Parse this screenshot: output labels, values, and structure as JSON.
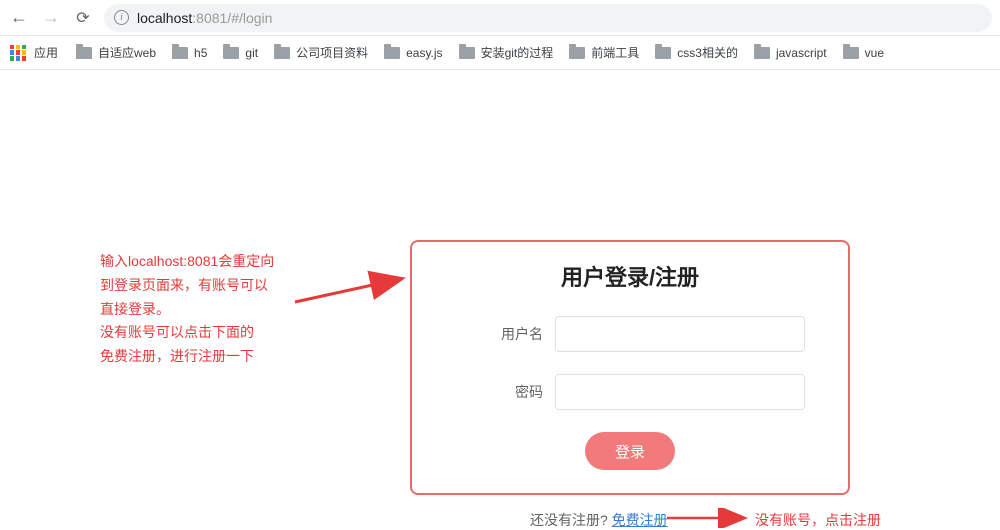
{
  "browser": {
    "url_host": "localhost",
    "url_rest": ":8081/#/login"
  },
  "bookmarks": {
    "apps_label": "应用",
    "items": [
      "自适应web",
      "h5",
      "git",
      "公司项目资料",
      "easy.js",
      "安装git的过程",
      "前端工具",
      "css3相关的",
      "javascript",
      "vue"
    ]
  },
  "annotations": {
    "left_line1": "输入localhost:8081会重定向",
    "left_line2": "到登录页面来，有账号可以",
    "left_line3": "直接登录。",
    "left_line4": "没有账号可以点击下面的",
    "left_line5": "免费注册，进行注册一下",
    "right": "没有账号，点击注册"
  },
  "login": {
    "title": "用户登录/注册",
    "username_label": "用户名",
    "password_label": "密码",
    "button": "登录"
  },
  "register": {
    "prompt": "还没有注册?",
    "link": "免费注册"
  }
}
